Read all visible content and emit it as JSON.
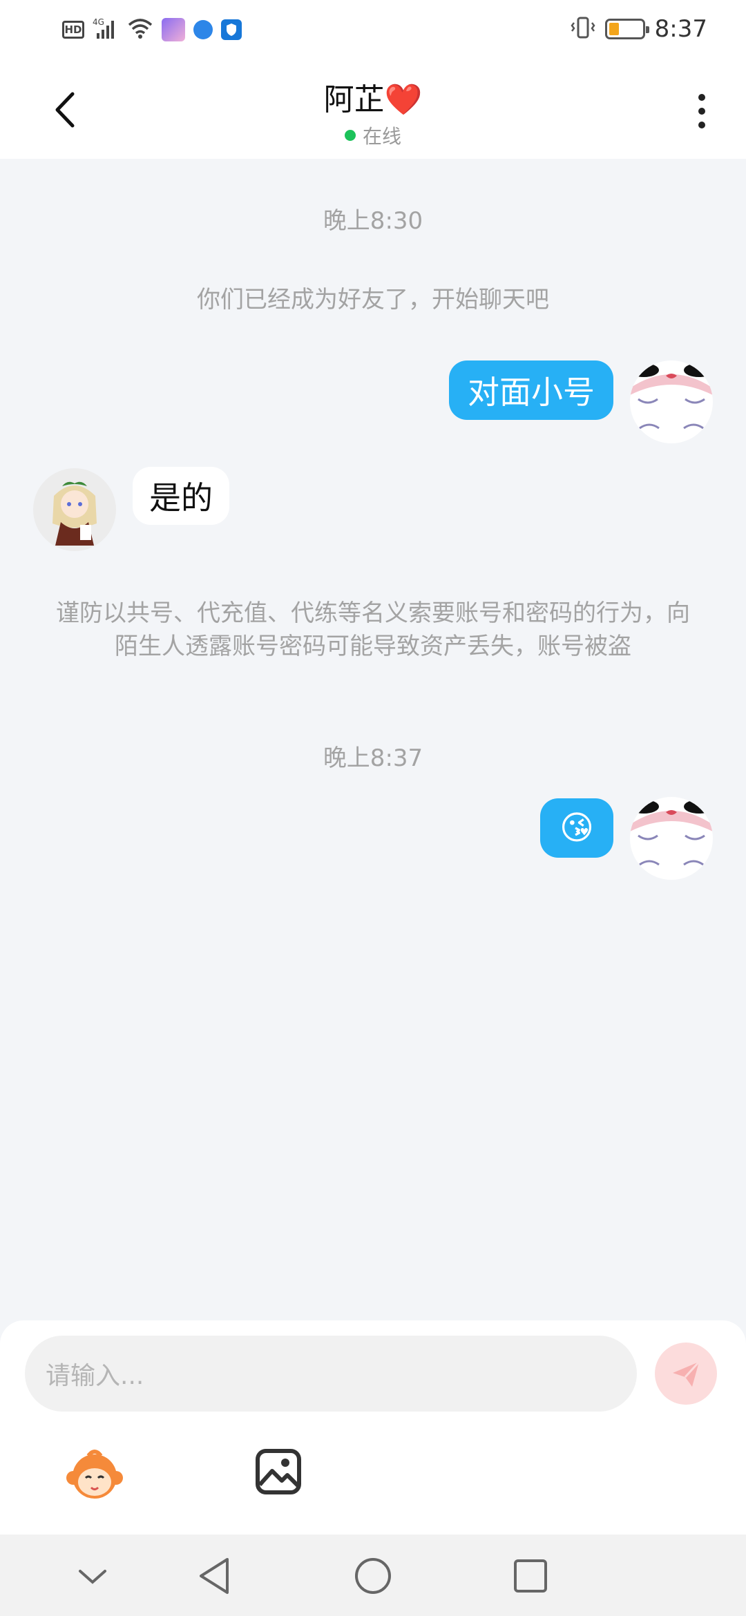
{
  "status_bar": {
    "hd": "HD",
    "network": "4G",
    "time": "8:37"
  },
  "header": {
    "title": "阿芷",
    "heart": "❤️",
    "status": "在线",
    "status_color": "#1cc25a"
  },
  "messages": {
    "time_1": "晚上8:30",
    "system_friend": "你们已经成为好友了，开始聊天吧",
    "msg_out_1": "对面小号",
    "msg_in_1": "是的",
    "system_warning": "谨防以共号、代充值、代练等名义索要账号和密码的行为，向陌生人透露账号密码可能导致资产丢失，账号被盗",
    "time_2": "晚上8:37",
    "msg_out_2": "😘"
  },
  "composer": {
    "placeholder": "请输入..."
  },
  "colors": {
    "accent_blue": "#27b0f5",
    "background": "#f3f5f8"
  },
  "icons": [
    "back-arrow-icon",
    "more-vertical-icon",
    "send-icon",
    "emoji-monkey-icon",
    "image-icon",
    "nav-collapse-icon",
    "nav-back-icon",
    "nav-home-icon",
    "nav-recents-icon"
  ]
}
